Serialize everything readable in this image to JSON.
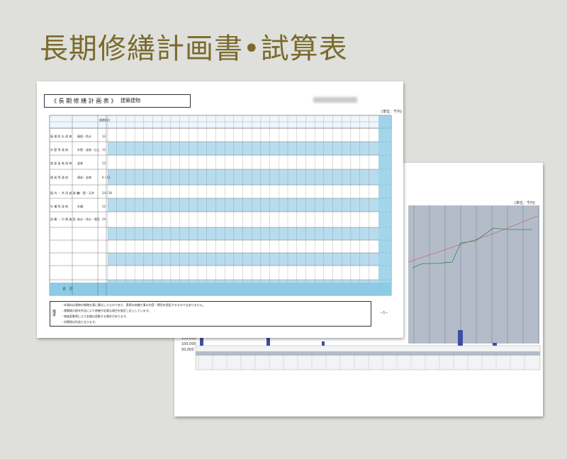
{
  "heading": "長期修繕計画書•試算表",
  "front_sheet": {
    "table_title": "《 長 期 修 繕 計 画 表 》",
    "table_subtitle": "建築建物",
    "unit_note": "(単位：千円)",
    "remarks_label": "備考",
    "page_mark": "−1−",
    "total_label": "合　計",
    "row_labels": [
      "屋 根 防 水 改 修",
      "外 壁 等 改 修",
      "鉄 部 塗 装 改 修",
      "建 具 等 改 修",
      "屋 内 ・ 共 用 部 改 修",
      "外 構 等 改 修",
      "設 備 ・ 付 属 施 設"
    ],
    "row_sublabels": [
      "屋根・防水",
      "外壁・塗装・仕上",
      "塗装",
      "建具・金物",
      "床・壁・天井",
      "外構",
      "給水・排水・電気"
    ],
    "row_cycle": [
      "12",
      "12",
      "12",
      "6 / 12",
      "24 / 36",
      "12",
      "24"
    ],
    "col_header_cycle": "周期(年)",
    "notes": [
      "・本資料は建物の概略を基に算出したものであり、実際の修繕工事の内容・費用を保証するものではありません。",
      "・建築後の経年劣化により修繕が必要な項目を推定し計上しています。",
      "・物価変動等により金額は変動する場合があります。",
      "・消費税は別途となります。"
    ]
  },
  "back_sheet": {
    "unit_note": "(単位：千円)",
    "axis_labels": [
      "150,000",
      "100,000",
      "50,000"
    ]
  },
  "colors": {
    "heading": "#7a6a2c",
    "sheet": "#ffffff",
    "table_band": "#b7dcee",
    "table_header": "#8ccae6",
    "bar": "#3d4fa3",
    "line_red": "#e04040",
    "line_green": "#2e8a4e",
    "chart_bg": "#b4bcc9"
  }
}
